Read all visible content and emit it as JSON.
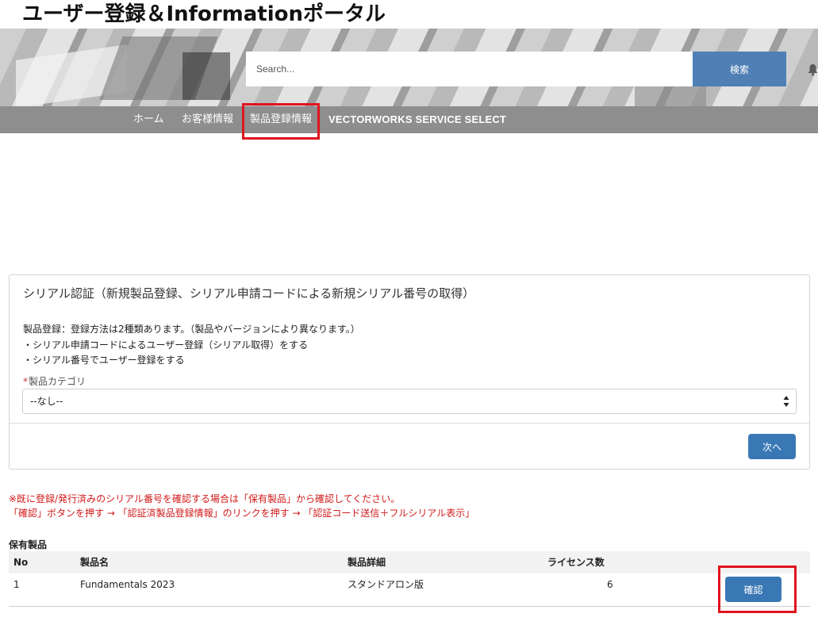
{
  "header": {
    "site_title": "ユーザー登録＆Informationポータル"
  },
  "search": {
    "placeholder": "Search...",
    "button_label": "検索"
  },
  "icons": {
    "notification": "bell-icon",
    "select_arrows": "sort-arrows-icon"
  },
  "nav": {
    "items": [
      {
        "label": "ホーム"
      },
      {
        "label": "お客様情報"
      },
      {
        "label": "製品登録情報"
      },
      {
        "label": "VECTORWORKS SERVICE SELECT"
      }
    ]
  },
  "serial_card": {
    "title": "シリアル認証（新規製品登録、シリアル申請コードによる新規シリアル番号の取得）",
    "description_lines": [
      "製品登録：登録方法は2種類あります。（製品やバージョンにより異なります。）",
      "・シリアル申請コードによるユーザー登録（シリアル取得）をする",
      "・シリアル番号でユーザー登録をする"
    ],
    "category_field": {
      "required_mark": "*",
      "label": "製品カテゴリ",
      "selected_value": "--なし--"
    },
    "next_button_label": "次へ"
  },
  "notice": {
    "lines": [
      "※既に登録/発行済みのシリアル番号を確認する場合は「保有製品」から確認してください。",
      "「確認」ボタンを押す → 「認証済製品登録情報」のリンクを押す → 「認証コード送信＋フルシリアル表示」"
    ]
  },
  "owned_products": {
    "heading": "保有製品",
    "columns": [
      "No",
      "製品名",
      "製品詳細",
      "ライセンス数"
    ],
    "rows": [
      {
        "no": "1",
        "name": "Fundamentals 2023",
        "detail": "スタンドアロン版",
        "licenses": "6",
        "action_label": "確認"
      }
    ]
  },
  "colors": {
    "nav_background": "#8e8e8e",
    "search_button": "#4f7fb5",
    "primary_button": "#3a78b5",
    "highlight_border": "#e0141e",
    "notice_text": "#d11a1a"
  }
}
